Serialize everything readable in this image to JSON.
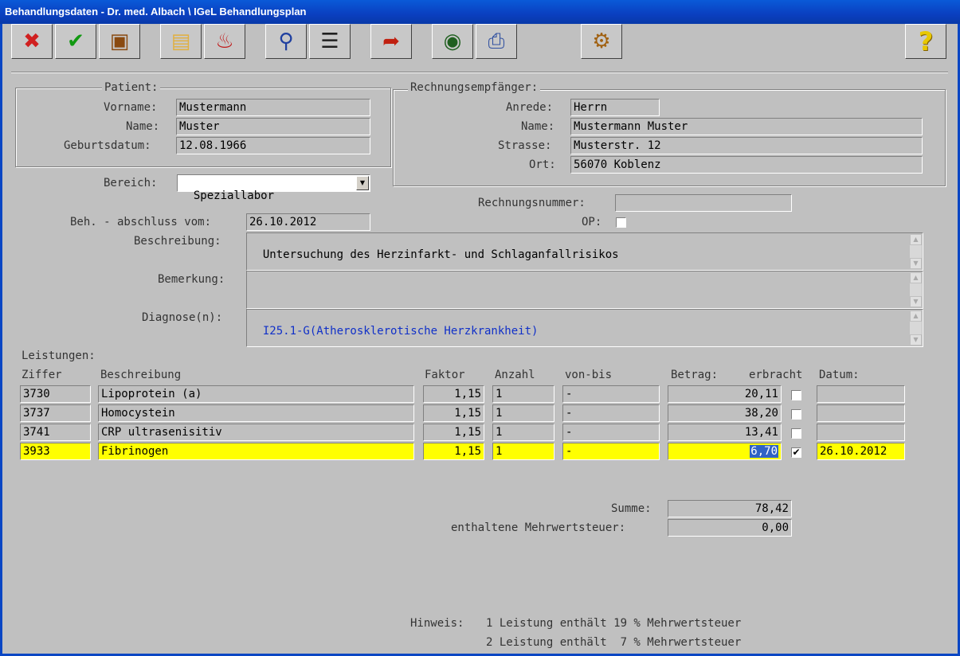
{
  "window": {
    "title": "Behandlungsdaten - Dr. med. Albach \\ IGeL Behandlungsplan"
  },
  "toolbar": {
    "buttons": [
      {
        "name": "cancel",
        "icon": "red-x-icon",
        "glyph": "✖",
        "color": "#d02020"
      },
      {
        "name": "ok",
        "icon": "green-check-icon",
        "glyph": "✔",
        "color": "#119911"
      },
      {
        "name": "archive",
        "icon": "box-icon",
        "glyph": "▣",
        "color": "#8a4a10"
      },
      {
        "name": "open",
        "icon": "folder-icon",
        "glyph": "▤",
        "color": "#e0b040"
      },
      {
        "name": "delete",
        "icon": "trash-icon",
        "glyph": "♨",
        "color": "#c01818"
      },
      {
        "name": "search",
        "icon": "magnifier-icon",
        "glyph": "⚲",
        "color": "#2040a0"
      },
      {
        "name": "list",
        "icon": "numbered-list-icon",
        "glyph": "☰",
        "color": "#202020"
      },
      {
        "name": "export",
        "icon": "clipboard-arrow-icon",
        "glyph": "➦",
        "color": "#c02010"
      },
      {
        "name": "preview",
        "icon": "eye-document-icon",
        "glyph": "◉",
        "color": "#206020"
      },
      {
        "name": "print",
        "icon": "printer-icon",
        "glyph": "⎙",
        "color": "#3050a0"
      },
      {
        "name": "settings",
        "icon": "gears-icon",
        "glyph": "⚙",
        "color": "#a06010"
      },
      {
        "name": "help",
        "icon": "help-question-icon",
        "glyph": "?",
        "color": "#e8c800"
      }
    ]
  },
  "patient": {
    "legend": "Patient:",
    "vorname_label": "Vorname:",
    "vorname": "Mustermann",
    "name_label": "Name:",
    "name": "Muster",
    "geb_label": "Geburtsdatum:",
    "geb": "12.08.1966"
  },
  "empfaenger": {
    "legend": "Rechnungsempfänger:",
    "anrede_label": "Anrede:",
    "anrede": "Herrn",
    "name_label": "Name:",
    "name": "Mustermann Muster",
    "strasse_label": "Strasse:",
    "strasse": "Musterstr. 12",
    "ort_label": "Ort:",
    "ort": "56070 Koblenz"
  },
  "bereich": {
    "label": "Bereich:",
    "value": "Speziallabor"
  },
  "rechnungsnummer": {
    "label": "Rechnungsnummer:",
    "value": ""
  },
  "op": {
    "label": "OP:",
    "checked": false
  },
  "abschluss": {
    "label": "Beh. - abschluss vom:",
    "value": "26.10.2012"
  },
  "beschreibung": {
    "label": "Beschreibung:",
    "value": "Untersuchung des Herzinfarkt- und Schlaganfallrisikos"
  },
  "bemerkung": {
    "label": "Bemerkung:",
    "value": ""
  },
  "diagnose": {
    "label": "Diagnose(n):",
    "value": "I25.1-G(Atherosklerotische Herzkrankheit)"
  },
  "leistungen": {
    "title": "Leistungen:",
    "headers": {
      "ziffer": "Ziffer",
      "beschreibung": "Beschreibung",
      "faktor": "Faktor",
      "anzahl": "Anzahl",
      "vonbis": "von-bis",
      "betrag": "Betrag:",
      "erbracht": "erbracht",
      "datum": "Datum:"
    },
    "rows": [
      {
        "ziffer": "3730",
        "beschreibung": "Lipoprotein (a)",
        "faktor": "1,15",
        "anzahl": "1",
        "vonbis": "-",
        "betrag": "20,11",
        "erbracht": "",
        "datum": "",
        "selected": false
      },
      {
        "ziffer": "3737",
        "beschreibung": "Homocystein",
        "faktor": "1,15",
        "anzahl": "1",
        "vonbis": "-",
        "betrag": "38,20",
        "erbracht": "",
        "datum": "",
        "selected": false
      },
      {
        "ziffer": "3741",
        "beschreibung": "CRP ultrasenisitiv",
        "faktor": "1,15",
        "anzahl": "1",
        "vonbis": "-",
        "betrag": "13,41",
        "erbracht": "",
        "datum": "",
        "selected": false
      },
      {
        "ziffer": "3933",
        "beschreibung": "Fibrinogen",
        "faktor": "1,15",
        "anzahl": "1",
        "vonbis": "-",
        "betrag": "6,70",
        "erbracht": "✔",
        "datum": "26.10.2012",
        "selected": true
      }
    ]
  },
  "summe": {
    "label": "Summe:",
    "value": "78,42"
  },
  "mwst": {
    "label": "enthaltene Mehrwertsteuer:",
    "value": "0,00"
  },
  "hinweis": {
    "label": "Hinweis:",
    "line1": "1 Leistung enthält 19 % Mehrwertsteuer",
    "line2": "2 Leistung enthält  7 % Mehrwertsteuer"
  }
}
